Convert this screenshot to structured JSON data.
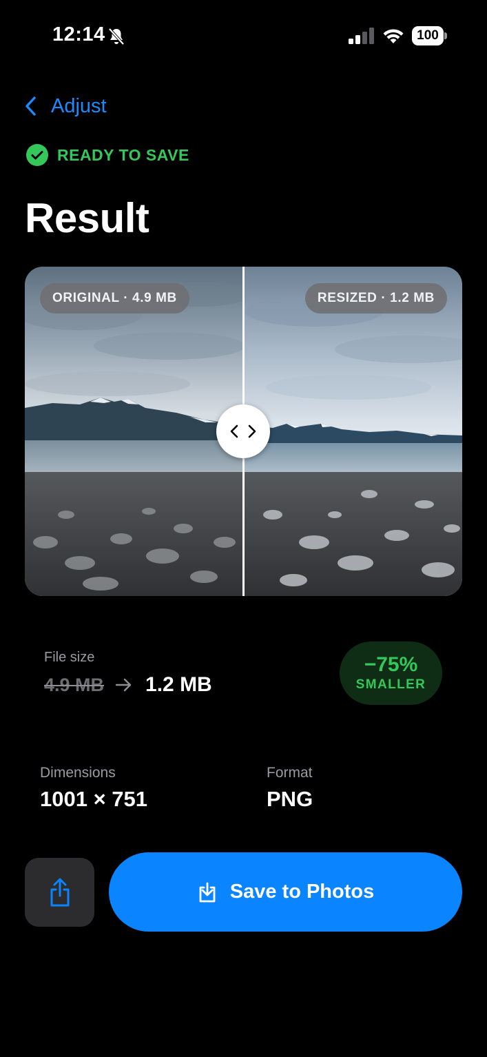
{
  "status_bar": {
    "time": "12:14",
    "battery": "100",
    "icons": [
      "bell-slash-icon",
      "cellular-signal-icon",
      "wifi-icon",
      "battery-icon"
    ]
  },
  "nav": {
    "back_label": "Adjust",
    "back_icon": "chevron-left-icon"
  },
  "status": {
    "label": "READY TO SAVE",
    "icon": "checkmark-circle-icon",
    "color": "#34c759"
  },
  "title": "Result",
  "comparison": {
    "original_label": "ORIGINAL · 4.9 MB",
    "resized_label": "RESIZED · 1.2 MB",
    "handle_icon": "chevron-left-right-icon"
  },
  "file_size": {
    "label": "File size",
    "original": "4.9 MB",
    "resized": "1.2 MB",
    "arrow_icon": "arrow-right-icon"
  },
  "savings": {
    "percent": "−75%",
    "label": "SMALLER",
    "color": "#34c759"
  },
  "dimensions": {
    "label": "Dimensions",
    "value": "1001 × 751"
  },
  "format": {
    "label": "Format",
    "value": "PNG"
  },
  "actions": {
    "share_icon": "share-icon",
    "save_label": "Save to Photos",
    "save_icon": "download-tray-icon",
    "accent": "#0a84ff"
  }
}
